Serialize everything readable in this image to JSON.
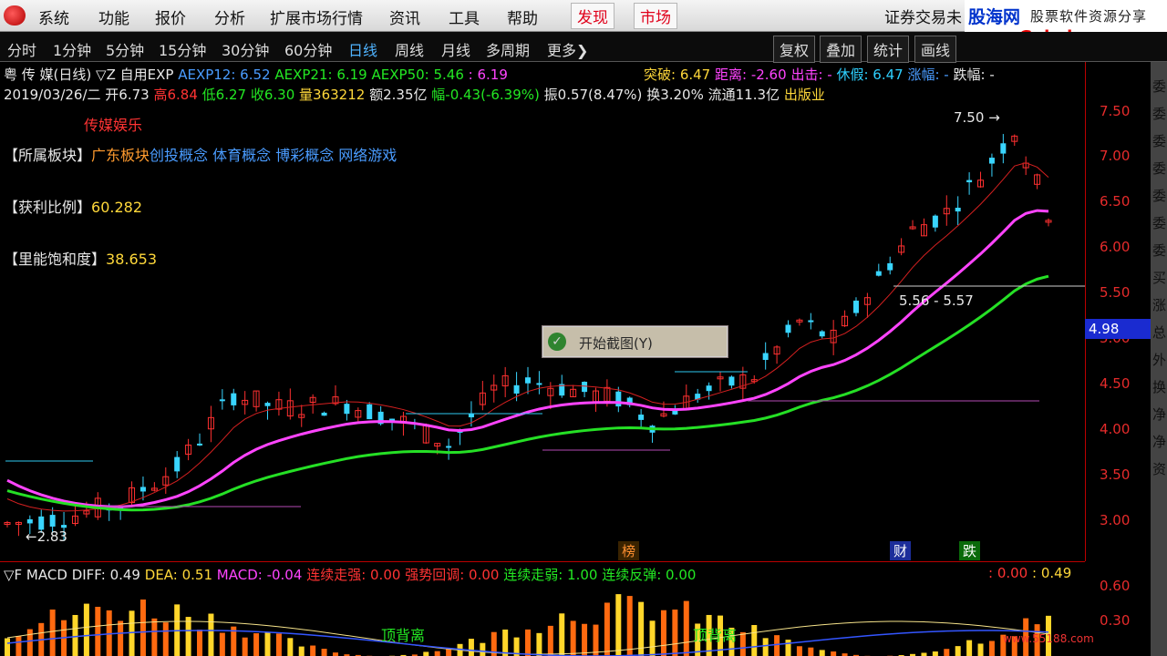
{
  "menu": {
    "items": [
      "系统",
      "功能",
      "报价",
      "分析",
      "扩展市场行情",
      "资讯",
      "工具",
      "帮助"
    ],
    "red_items": [
      "发现",
      "市场"
    ],
    "brand": "证券交易未"
  },
  "watermark": {
    "site_name": "股海网",
    "tagline": "股票软件资源分享",
    "url": "www.Guhai.com.cn",
    "footer_url": "www.55188.com"
  },
  "period_tabs": [
    "分时",
    "1分钟",
    "5分钟",
    "15分钟",
    "30分钟",
    "60分钟",
    "日线",
    "周线",
    "月线",
    "多周期",
    "更多"
  ],
  "active_period": "日线",
  "tools": [
    "复权",
    "叠加",
    "统计",
    "画线"
  ],
  "header": {
    "stock": "粤 传 媒(日线)",
    "indicator": "▽Z 自用EXP",
    "aexp12": "AEXP12: 6.52",
    "aexp21": "AEXP21: 6.19",
    "aexp50": "AEXP50: 5.46",
    "extra": ": 6.19",
    "breakout": "突破: 6.47",
    "distance": "距离: -2.60",
    "chuji": "出击: -",
    "xiujia": "休假: 6.47",
    "zhangfu": "涨幅: -",
    "diefu": "跌幅: -"
  },
  "quote": {
    "date": "2019/03/26/二",
    "open": "开6.73",
    "high": "高6.84",
    "low": "低6.27",
    "close": "收6.30",
    "volume": "量363212",
    "amount": "额2.35亿",
    "change": "幅-0.43(-6.39%)",
    "amplitude": "振0.57(8.47%)",
    "turnover": "换3.20%",
    "float": "流通11.3亿",
    "industry": "出版业"
  },
  "panel": {
    "sector_title": "传媒娱乐",
    "sector_label": "【所属板块】",
    "sectors_orange": "广东板块",
    "sectors_blue": "创投概念 体育概念 博彩概念 网络游戏",
    "profit_label": "【获利比例】",
    "profit_value": "60.282",
    "energy_label": "【里能饱和度】",
    "energy_value": "38.653"
  },
  "y_ticks": [
    "7.50",
    "7.00",
    "6.50",
    "6.00",
    "5.50",
    "5.00",
    "4.50",
    "4.00",
    "3.50",
    "3.00"
  ],
  "annotations": {
    "high": "7.50",
    "low": "2.83",
    "range": "5.56 - 5.57",
    "price_flag": "4.98",
    "badge_list": "榜",
    "badge_fin": "财",
    "badge_drop": "跌"
  },
  "dialog": {
    "label": "开始截图(Y)"
  },
  "macd": {
    "title": "▽F MACD",
    "diff": "DIFF: 0.49",
    "dea": "DEA: 0.51",
    "macd": "MACD: -0.04",
    "s1": "连续走强: 0.00",
    "s2": "强势回调: 0.00",
    "s3": "连续走弱: 1.00",
    "s4": "连续反弹: 0.00",
    "r1": ": 0.00",
    "r2": ": 0.49",
    "ticks": [
      "0.60",
      "0.30"
    ],
    "div1": "顶背离",
    "div2": "顶背离"
  },
  "right_strip": "委委委委委委委买涨总外换净净资"
}
